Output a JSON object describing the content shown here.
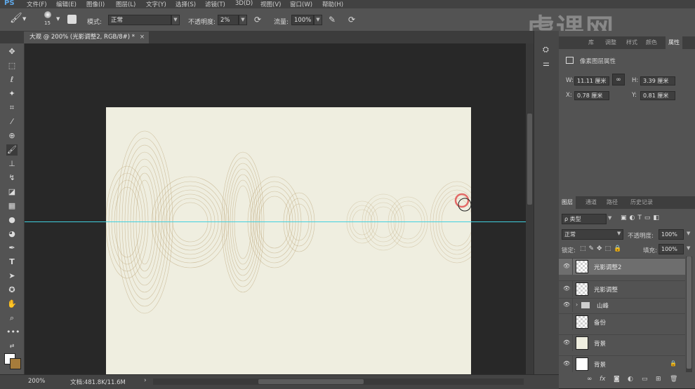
{
  "app": {
    "logo": "PS"
  },
  "menu": [
    "文件(F)",
    "编辑(E)",
    "图像(I)",
    "图层(L)",
    "文字(Y)",
    "选择(S)",
    "滤镜(T)",
    "3D(D)",
    "视图(V)",
    "窗口(W)",
    "帮助(H)"
  ],
  "options": {
    "brush_size": "15",
    "mode_label": "模式:",
    "mode_value": "正常",
    "opacity_label": "不透明度:",
    "opacity_value": "2%",
    "flow_label": "流量:",
    "flow_value": "100%"
  },
  "document": {
    "tab_title": "大观 @ 200% (光影调整2, RGB/8#) *",
    "close_glyph": "×"
  },
  "status": {
    "zoom": "200%",
    "doc_info": "文档:481.8K/11.6M",
    "arrow": "›"
  },
  "properties": {
    "tabs": [
      "库",
      "调整",
      "样式",
      "颜色",
      "属性"
    ],
    "active_tab": 4,
    "section_title": "像素图层属性",
    "w_label": "W:",
    "w_value": "11.11 厘米",
    "h_label": "H:",
    "h_value": "3.39 厘米",
    "x_label": "X:",
    "x_value": "0.78 厘米",
    "y_label": "Y:",
    "y_value": "0.81 厘米"
  },
  "layers_panel": {
    "tabs": [
      "图层",
      "通道",
      "路径",
      "历史记录"
    ],
    "active_tab": 0,
    "filter_value": "ρ 类型",
    "blend_mode": "正常",
    "opacity_label": "不透明度:",
    "opacity_value": "100%",
    "lock_label": "锁定:",
    "fill_label": "填充:",
    "fill_value": "100%",
    "layers": [
      {
        "name": "光影调整2",
        "visible": true,
        "selected": true,
        "thumb": "transparent"
      },
      {
        "name": "光影调整",
        "visible": true,
        "selected": false,
        "thumb": "transparent"
      },
      {
        "name": "山峰",
        "visible": true,
        "selected": false,
        "thumb": "folder"
      },
      {
        "name": "备份",
        "visible": false,
        "selected": false,
        "thumb": "transparent"
      },
      {
        "name": "背景",
        "visible": true,
        "selected": false,
        "thumb": "cream"
      },
      {
        "name": "背景",
        "visible": true,
        "selected": false,
        "thumb": "white",
        "locked": true
      }
    ],
    "footer_icons": [
      "link-icon",
      "fx-icon",
      "mask-icon",
      "adjustment-icon",
      "group-icon",
      "new-layer-icon",
      "trash-icon"
    ]
  },
  "watermark": {
    "text": "虎课网"
  },
  "colors": {
    "foreground": "#ffffff",
    "background": "#a67c3b",
    "canvas": "#efeee0",
    "guide": "#3fd0e0",
    "mountain": "#b59a6a"
  }
}
